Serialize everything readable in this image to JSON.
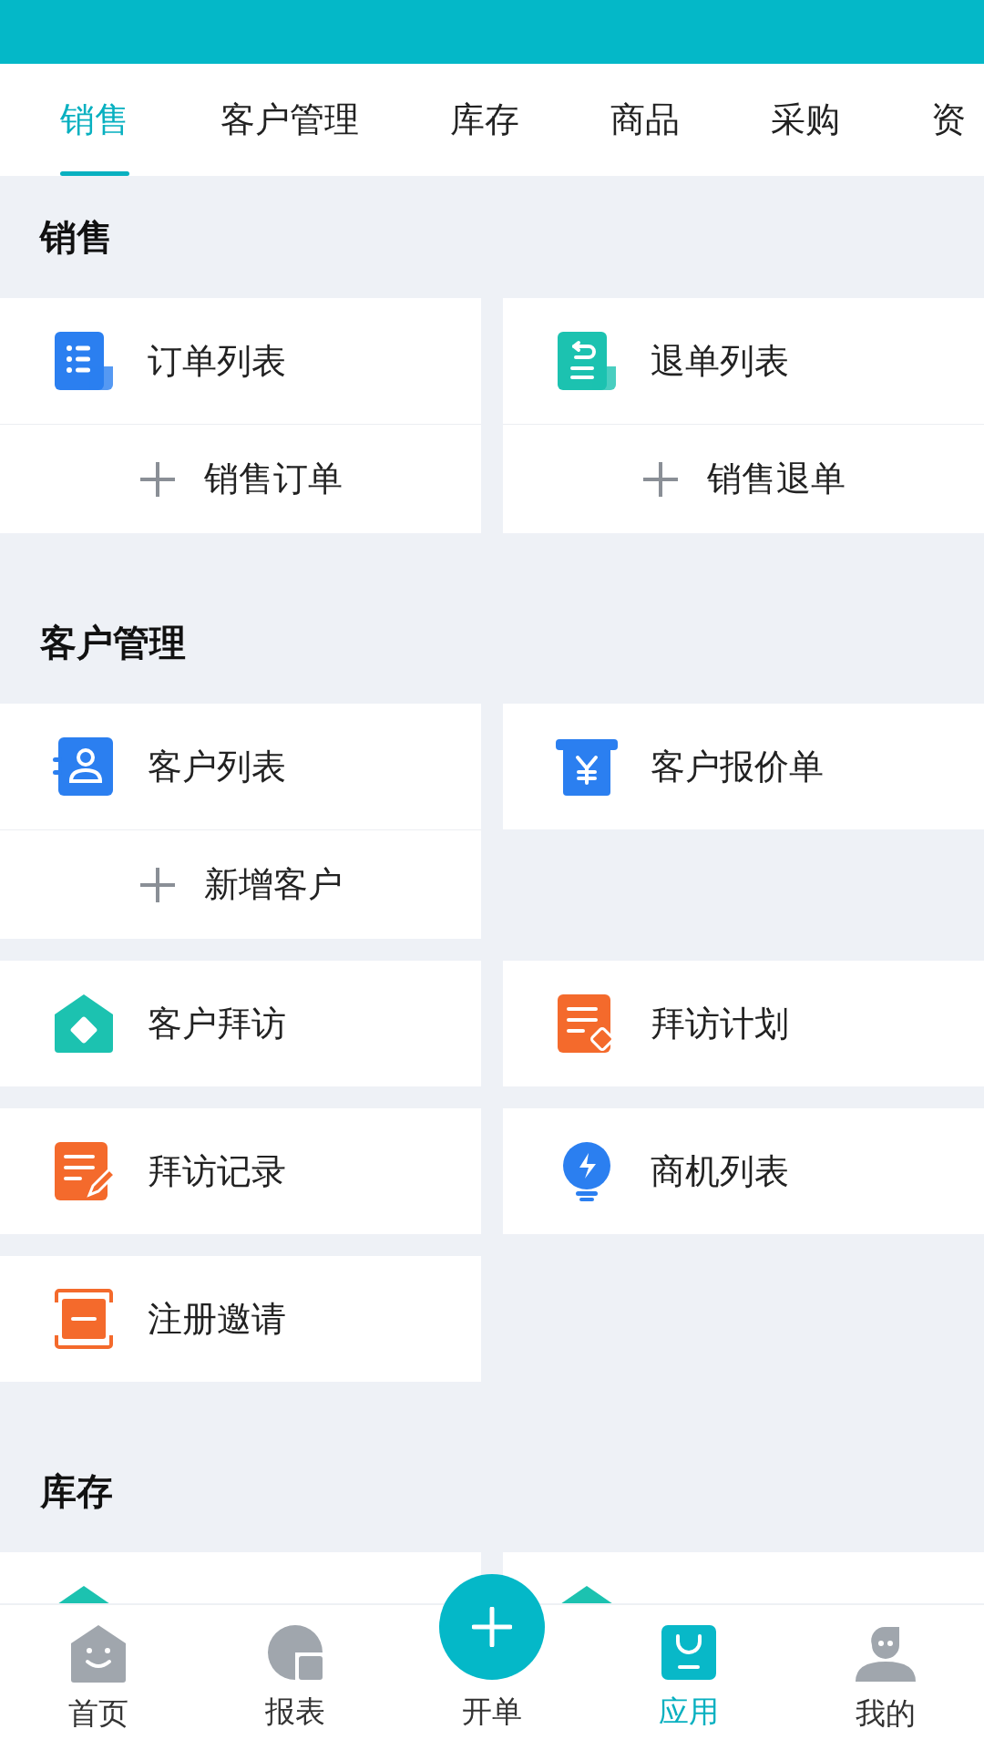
{
  "tabs": [
    {
      "label": "销售",
      "selected": true
    },
    {
      "label": "客户管理",
      "selected": false
    },
    {
      "label": "库存",
      "selected": false
    },
    {
      "label": "商品",
      "selected": false
    },
    {
      "label": "采购",
      "selected": false
    },
    {
      "label": "资",
      "selected": false
    }
  ],
  "sections": [
    {
      "title": "销售",
      "rows": [
        [
          {
            "label": "订单列表",
            "kind": "list-blue",
            "add_label": "销售订单"
          },
          {
            "label": "退单列表",
            "kind": "return-teal",
            "add_label": "销售退单"
          }
        ]
      ]
    },
    {
      "title": "客户管理",
      "rows": [
        [
          {
            "label": "客户列表",
            "kind": "contact-blue",
            "add_label": "新增客户"
          },
          {
            "label": "客户报价单",
            "kind": "quote-blue"
          }
        ],
        [
          {
            "label": "客户拜访",
            "kind": "house-teal"
          },
          {
            "label": "拜访计划",
            "kind": "plan-orange"
          }
        ],
        [
          {
            "label": "拜访记录",
            "kind": "record-orange"
          },
          {
            "label": "商机列表",
            "kind": "bulb-blue"
          }
        ],
        [
          {
            "label": "注册邀请",
            "kind": "invite-orange"
          }
        ]
      ]
    },
    {
      "title": "库存",
      "rows": [
        [
          {
            "kind": "house-teal"
          },
          {
            "kind": "house-teal"
          }
        ]
      ]
    }
  ],
  "nav": [
    {
      "label": "首页",
      "kind": "home",
      "selected": false
    },
    {
      "label": "报表",
      "kind": "report",
      "selected": false
    },
    {
      "label": "开单",
      "kind": "fab",
      "selected": false
    },
    {
      "label": "应用",
      "kind": "bag",
      "selected": true
    },
    {
      "label": "我的",
      "kind": "person",
      "selected": false
    }
  ]
}
